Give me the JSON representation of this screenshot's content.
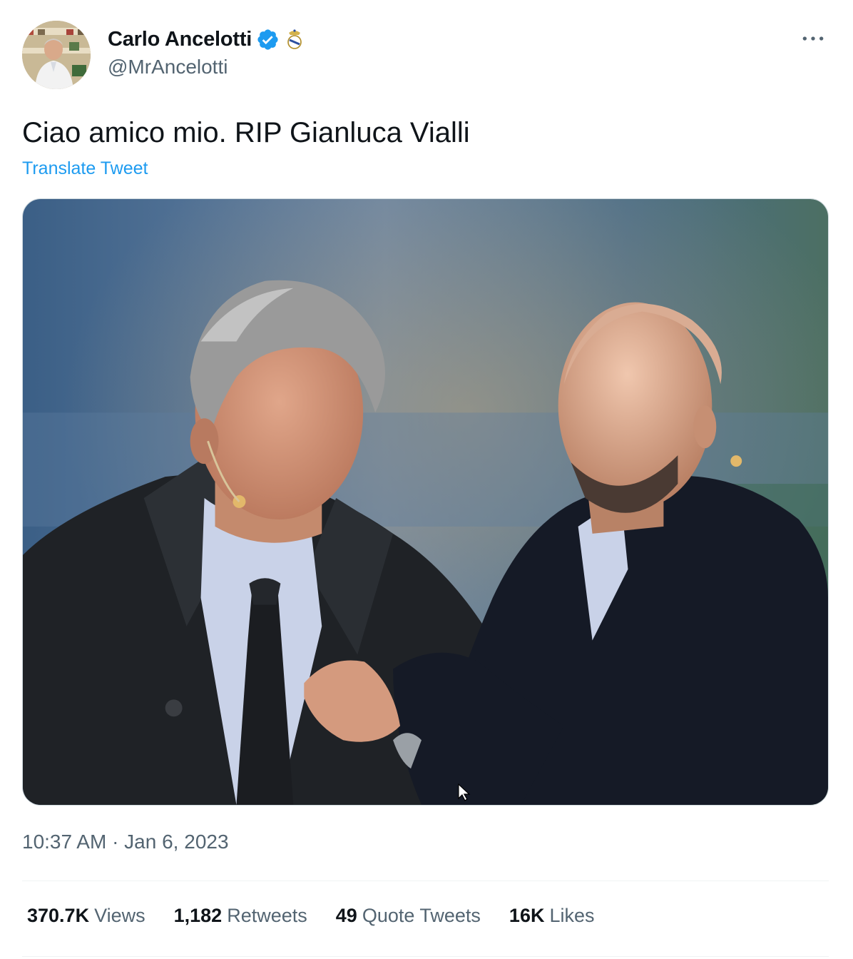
{
  "tweet": {
    "author": {
      "display_name": "Carlo Ancelotti",
      "handle": "@MrAncelotti",
      "verified": true,
      "badge_icon": "club-crest-icon"
    },
    "text": "Ciao amico mio. RIP Gianluca Vialli",
    "translate_label": "Translate Tweet",
    "timestamp": "10:37 AM · Jan 6, 2023",
    "stats": [
      {
        "count": "370.7K",
        "label": "Views"
      },
      {
        "count": "1,182",
        "label": "Retweets"
      },
      {
        "count": "49",
        "label": "Quote Tweets"
      },
      {
        "count": "16K",
        "label": "Likes"
      }
    ],
    "more_icon": "more-options-icon"
  },
  "colors": {
    "text_primary": "#0f1419",
    "text_secondary": "#536471",
    "accent": "#1d9bf0",
    "divider": "#eff3f4"
  }
}
